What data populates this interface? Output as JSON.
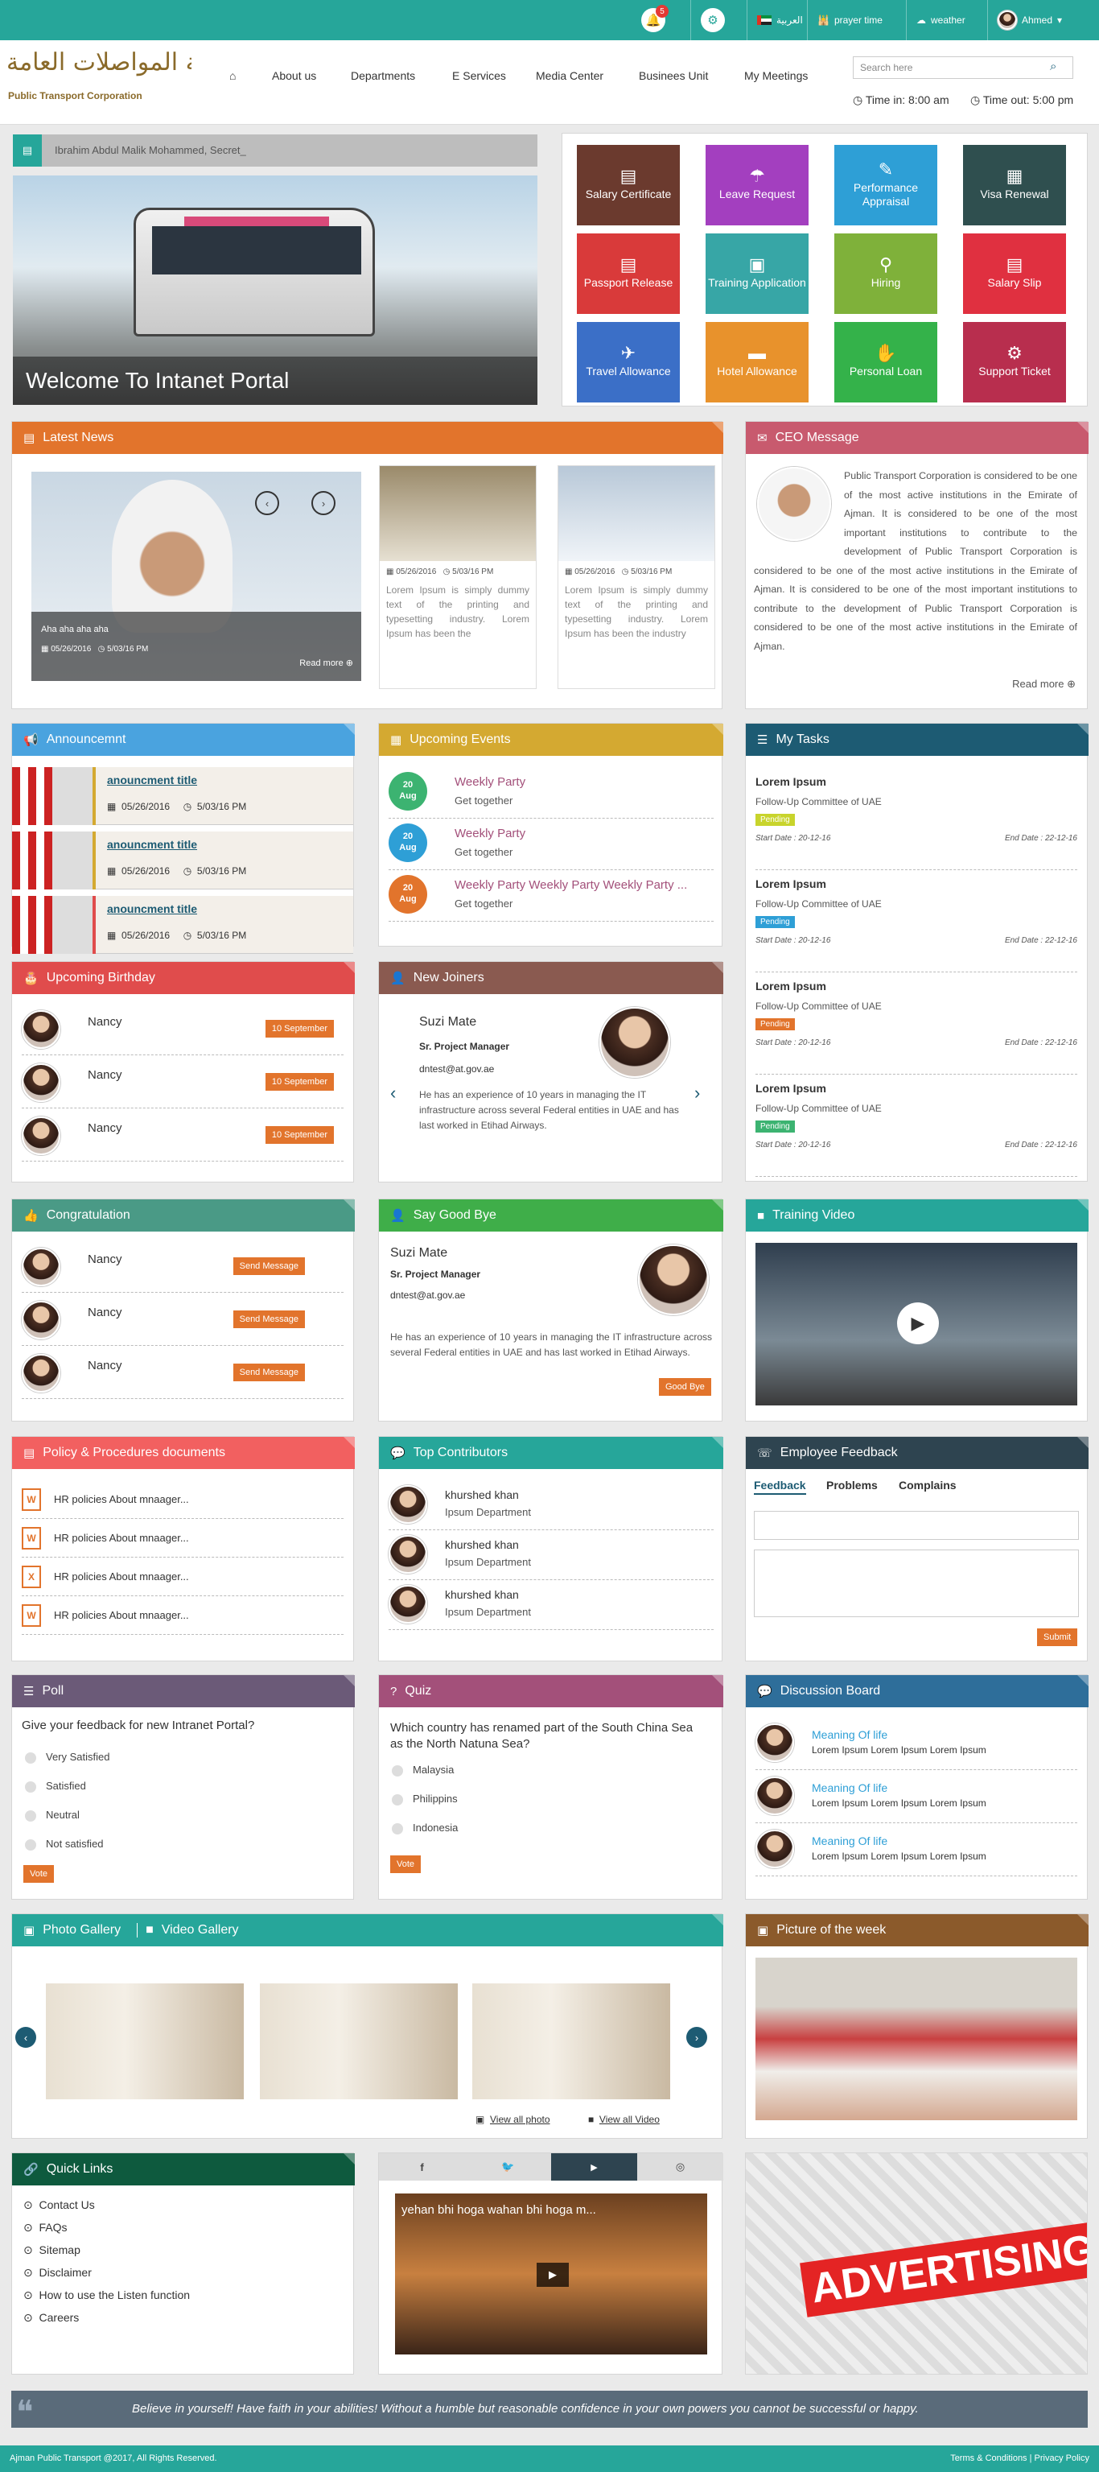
{
  "topbar": {
    "notif_count": "5",
    "lang": "العربية",
    "prayer": "prayer time",
    "weather": "weather",
    "user": "Ahmed"
  },
  "header": {
    "logo_ar": "مؤسسة المواصلات العامة",
    "logo_en": "Public Transport Corporation",
    "nav": [
      "About us",
      "Departments",
      "E Services",
      "Media Center",
      "Businees Unit",
      "My Meetings"
    ],
    "search_placeholder": "Search here",
    "time_in": "Time in: 8:00 am",
    "time_out": "Time out: 5:00 pm"
  },
  "ticker": "Ibrahim Abdul Malik Mohammed, Secret_",
  "hero": {
    "title": "Welcome To Intanet Portal"
  },
  "tiles": [
    "Salary Certificate",
    "Leave Request",
    "Performance Appraisal",
    "Visa Renewal",
    "Passport Release",
    "Training Application",
    "Hiring",
    "Salary Slip",
    "Travel Allowance",
    "Hotel Allowance",
    "Personal Loan",
    "Support Ticket"
  ],
  "news": {
    "title": "Latest News",
    "main_caption": "Aha aha aha aha",
    "main_date": "05/26/2016",
    "main_time": "5/03/16 PM",
    "read_more": "Read more",
    "items": [
      {
        "date": "05/26/2016",
        "time": "5/03/16 PM",
        "text": "Lorem Ipsum is simply dummy text of the printing and typesetting industry. Lorem Ipsum has been the"
      },
      {
        "date": "05/26/2016",
        "time": "5/03/16 PM",
        "text": "Lorem Ipsum is simply dummy text of the printing and typesetting industry. Lorem Ipsum has been the industry"
      }
    ]
  },
  "ceo": {
    "title": "CEO Message",
    "text": "Public Transport Corporation is considered to be one of the most active institutions in the Emirate of Ajman. It is considered to be one of the most important institutions to contribute to the development of Public Transport Corporation is considered to be one of the most active institutions in the Emirate of Ajman. It is considered to be one of the most important institutions to contribute to the development of Public Transport Corporation is considered to be one of the most active institutions in the Emirate of Ajman.",
    "read_more": "Read more"
  },
  "announcement": {
    "title": "Announcemnt",
    "items": [
      {
        "title": "anouncment title",
        "date": "05/26/2016",
        "time": "5/03/16 PM"
      },
      {
        "title": "anouncment title",
        "date": "05/26/2016",
        "time": "5/03/16 PM"
      },
      {
        "title": "anouncment title",
        "date": "05/26/2016",
        "time": "5/03/16 PM"
      }
    ]
  },
  "events": {
    "title": "Upcoming Events",
    "items": [
      {
        "day": "20",
        "mon": "Aug",
        "name": "Weekly Party",
        "sub": "Get together",
        "color": "#3cb371"
      },
      {
        "day": "20",
        "mon": "Aug",
        "name": "Weekly Party",
        "sub": "Get together",
        "color": "#2e9fd6"
      },
      {
        "day": "20",
        "mon": "Aug",
        "name": "Weekly Party Weekly Party Weekly Party ...",
        "sub": "Get together",
        "color": "#e2742c"
      }
    ]
  },
  "tasks": {
    "title": "My Tasks",
    "items": [
      {
        "name": "Lorem Ipsum",
        "org": "Follow-Up Committee of UAE",
        "status": "Pending",
        "color": "#c8d42c",
        "start": "Start Date : 20-12-16",
        "end": "End Date : 22-12-16"
      },
      {
        "name": "Lorem Ipsum",
        "org": "Follow-Up Committee of UAE",
        "status": "Pending",
        "color": "#2e9fd6",
        "start": "Start Date : 20-12-16",
        "end": "End Date : 22-12-16"
      },
      {
        "name": "Lorem Ipsum",
        "org": "Follow-Up Committee of UAE",
        "status": "Pending",
        "color": "#e2742c",
        "start": "Start Date : 20-12-16",
        "end": "End Date : 22-12-16"
      },
      {
        "name": "Lorem Ipsum",
        "org": "Follow-Up Committee of UAE",
        "status": "Pending",
        "color": "#3cb371",
        "start": "Start Date : 20-12-16",
        "end": "End Date : 22-12-16"
      }
    ]
  },
  "birthday": {
    "title": "Upcoming Birthday",
    "items": [
      {
        "name": "Nancy",
        "date": "10 September"
      },
      {
        "name": "Nancy",
        "date": "10 September"
      },
      {
        "name": "Nancy",
        "date": "10 September"
      }
    ]
  },
  "joiners": {
    "title": "New Joiners",
    "name": "Suzi Mate",
    "role": "Sr. Project Manager",
    "email": "dntest@at.gov.ae",
    "text": "He has an experience of 10 years in managing the IT infrastructure across several Federal entities in UAE and has last worked in Etihad Airways."
  },
  "congrats": {
    "title": "Congratulation",
    "button": "Send Message",
    "items": [
      "Nancy",
      "Nancy",
      "Nancy"
    ]
  },
  "goodbye": {
    "title": "Say Good Bye",
    "name": "Suzi Mate",
    "role": "Sr. Project Manager",
    "email": "dntest@at.gov.ae",
    "text": "He has an experience of 10 years in managing the IT infrastructure across several Federal entities in UAE and has last worked in Etihad Airways.",
    "button": "Good Bye"
  },
  "training": {
    "title": "Training Video"
  },
  "policy": {
    "title": "Policy & Procedures documents",
    "items": [
      "HR policies About mnaager...",
      "HR policies About mnaager...",
      "HR policies About mnaager...",
      "HR policies About mnaager..."
    ]
  },
  "contributors": {
    "title": "Top Contributors",
    "items": [
      {
        "name": "khurshed khan",
        "dept": "Ipsum Department"
      },
      {
        "name": "khurshed khan",
        "dept": "Ipsum Department"
      },
      {
        "name": "khurshed khan",
        "dept": "Ipsum Department"
      }
    ]
  },
  "feedback": {
    "title": "Employee Feedback",
    "tabs": [
      "Feedback",
      "Problems",
      "Complains"
    ],
    "submit": "Submit"
  },
  "poll": {
    "title": "Poll",
    "question": "Give your feedback for new Intranet Portal?",
    "options": [
      "Very Satisfied",
      "Satisfied",
      "Neutral",
      "Not satisfied"
    ],
    "vote": "Vote"
  },
  "quiz": {
    "title": "Quiz",
    "question": "Which country has renamed part of the South China Sea as the North Natuna Sea?",
    "options": [
      "Malaysia",
      "Philippins",
      "Indonesia"
    ],
    "vote": "Vote"
  },
  "discussion": {
    "title": "Discussion Board",
    "items": [
      {
        "title": "Meaning Of life",
        "text": "Lorem Ipsum Lorem Ipsum Lorem Ipsum"
      },
      {
        "title": "Meaning Of life",
        "text": "Lorem Ipsum Lorem Ipsum Lorem Ipsum"
      },
      {
        "title": "Meaning Of life",
        "text": "Lorem Ipsum Lorem Ipsum Lorem Ipsum"
      }
    ]
  },
  "gallery": {
    "photo_tab": "Photo Gallery",
    "video_tab": "Video Gallery",
    "view_photo": "View all photo",
    "view_video": "View all Video"
  },
  "picture_week": {
    "title": "Picture of the week"
  },
  "quicklinks": {
    "title": "Quick Links",
    "items": [
      "Contact Us",
      "FAQs",
      "Sitemap",
      "Disclaimer",
      "How to use the Listen function",
      "Careers"
    ]
  },
  "social": {
    "video_title": "yehan bhi hoga wahan bhi hoga m..."
  },
  "ad": {
    "word": "ADVERTISING"
  },
  "quote": "Believe in yourself! Have faith in your abilities! Without a humble but reasonable confidence in your own powers you cannot be successful or happy.",
  "footer": {
    "copyright": "Ajman Public Transport @2017, All Rights Reserved.",
    "links": "Terms & Conditions | Privacy Policy"
  }
}
